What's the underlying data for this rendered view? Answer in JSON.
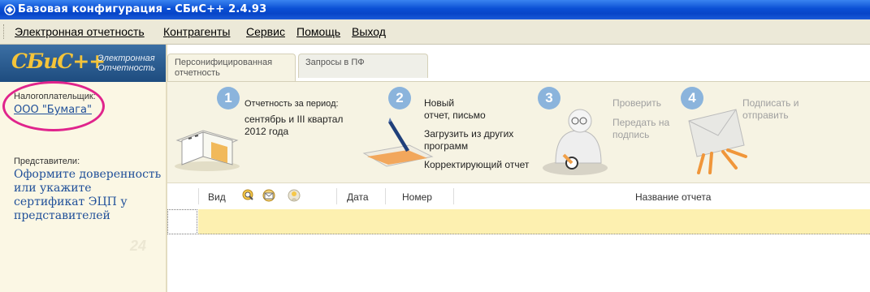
{
  "window": {
    "title": "Базовая конфигурация - СБиС++ 2.4.93"
  },
  "menu": {
    "items": [
      {
        "label": "Электронная отчетность"
      },
      {
        "label": "Контрагенты"
      },
      {
        "label": "Сервис"
      },
      {
        "label": "Помощь"
      },
      {
        "label": "Выход"
      }
    ]
  },
  "sidebar": {
    "logo": "СБиС++",
    "logo_sub_line1": "Электронная",
    "logo_sub_line2": "Отчетность",
    "taxpayer_label": "Налогоплательщик:",
    "taxpayer_name": "ООО \"Бумага\"",
    "representatives_label": "Представители:",
    "representatives_link": "Оформите доверенность или укажите сертификат ЭЦП у представителей",
    "watermark": "24"
  },
  "tabs": [
    {
      "label": "Персонифицированная отчетность",
      "active": true
    },
    {
      "label": "Запросы в ПФ",
      "active": false
    }
  ],
  "steps": [
    {
      "number": "1",
      "title": "Отчетность за период:",
      "value_line1": "сентябрь и III квартал",
      "value_line2": "2012 года"
    },
    {
      "number": "2",
      "new_label": "Новый",
      "new_line2": "отчет,  письмо",
      "load_label": "Загрузить из других",
      "load_line2": "программ",
      "corr_label": "Корректирующий отчет"
    },
    {
      "number": "3",
      "check_label": "Проверить",
      "send_label": "Передать на",
      "send_line2": "подпись"
    },
    {
      "number": "4",
      "sign_label": "Подписать и",
      "sign_line2": "отправить"
    }
  ],
  "table": {
    "columns": [
      "Вид",
      "Дата",
      "Номер",
      "Название отчета"
    ]
  },
  "colors": {
    "accent_blue": "#8bb4dc",
    "highlight": "#e0248c",
    "row_fill": "#fdf0b0"
  }
}
